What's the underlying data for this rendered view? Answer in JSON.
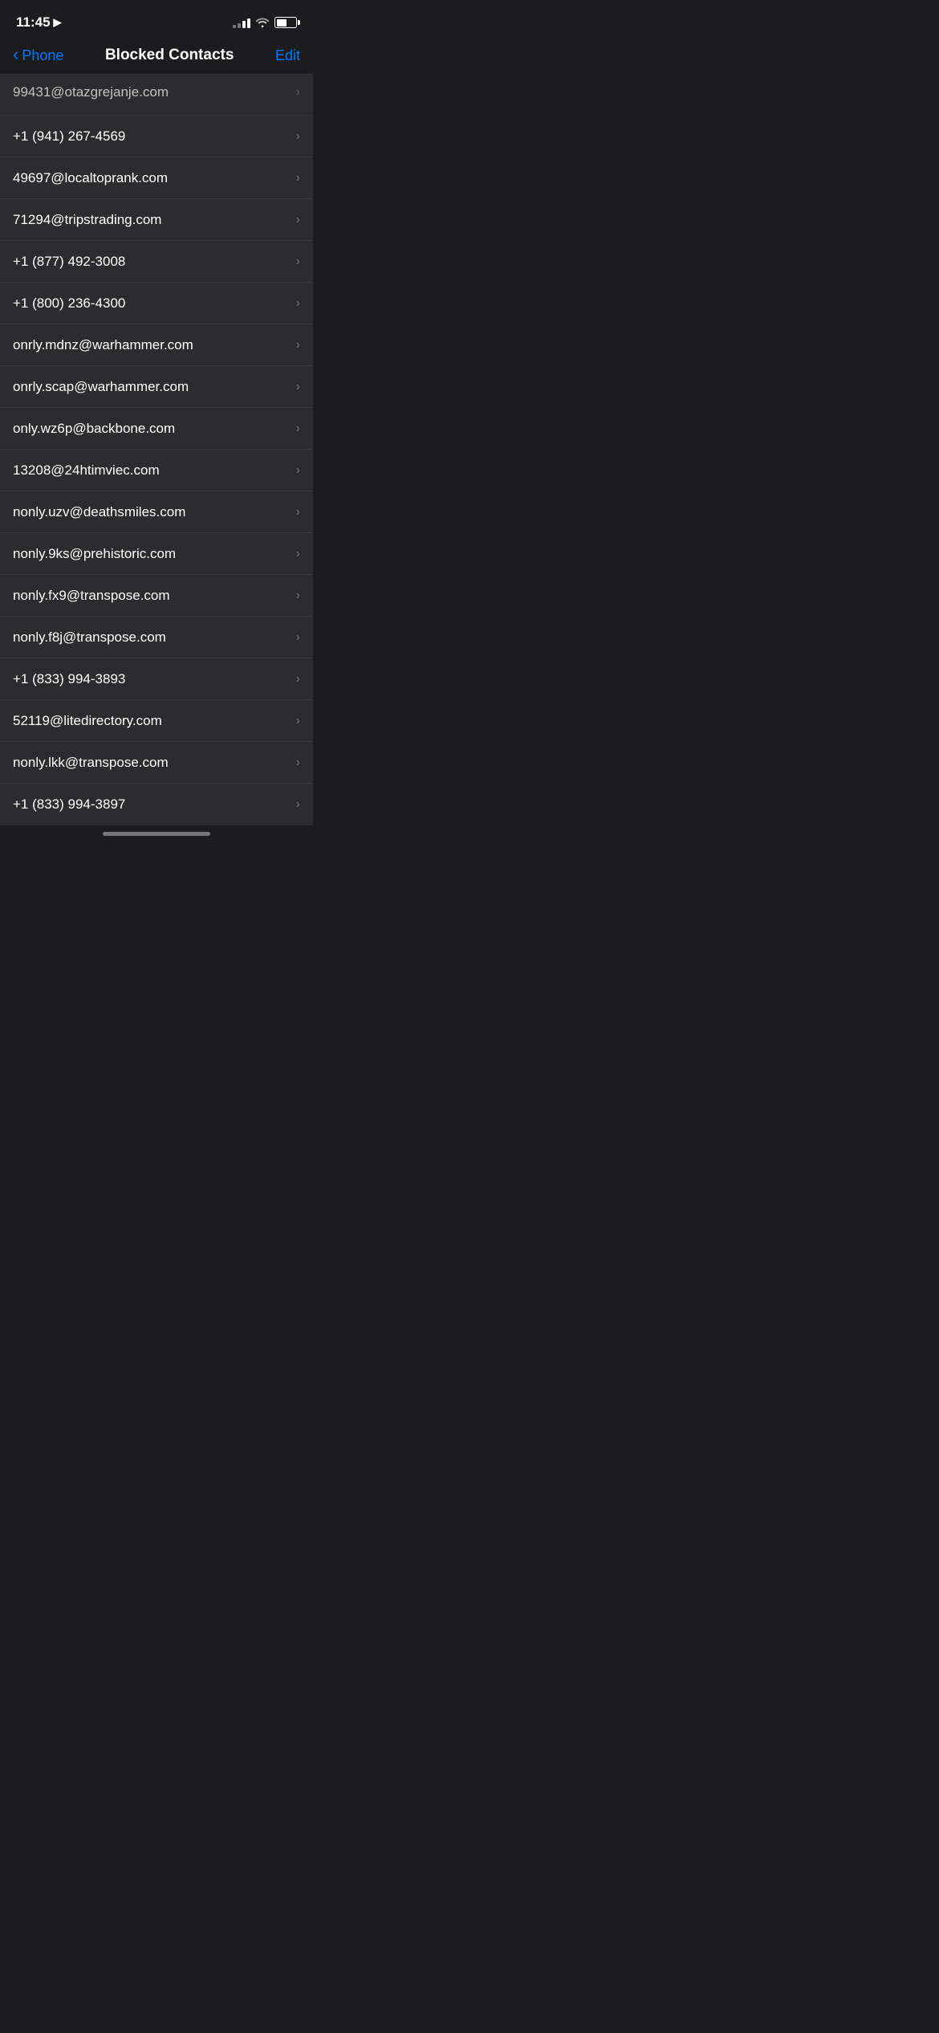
{
  "statusBar": {
    "time": "11:45",
    "locationIcon": "▶"
  },
  "navBar": {
    "backLabel": "Phone",
    "title": "Blocked Contacts",
    "editLabel": "Edit"
  },
  "contacts": [
    {
      "id": 1,
      "value": "99431@otazgrejanje.com",
      "partial": true
    },
    {
      "id": 2,
      "value": "+1 (941) 267-4569",
      "partial": false
    },
    {
      "id": 3,
      "value": "49697@localtoprank.com",
      "partial": false
    },
    {
      "id": 4,
      "value": "71294@tripstrading.com",
      "partial": false
    },
    {
      "id": 5,
      "value": "+1 (877) 492-3008",
      "partial": false
    },
    {
      "id": 6,
      "value": "+1 (800) 236-4300",
      "partial": false
    },
    {
      "id": 7,
      "value": "onrly.mdnz@warhammer.com",
      "partial": false
    },
    {
      "id": 8,
      "value": "onrly.scap@warhammer.com",
      "partial": false
    },
    {
      "id": 9,
      "value": "only.wz6p@backbone.com",
      "partial": false
    },
    {
      "id": 10,
      "value": "13208@24htimviec.com",
      "partial": false
    },
    {
      "id": 11,
      "value": "nonly.uzv@deathsmiles.com",
      "partial": false
    },
    {
      "id": 12,
      "value": "nonly.9ks@prehistoric.com",
      "partial": false
    },
    {
      "id": 13,
      "value": "nonly.fx9@transpose.com",
      "partial": false
    },
    {
      "id": 14,
      "value": "nonly.f8j@transpose.com",
      "partial": false
    },
    {
      "id": 15,
      "value": "+1 (833) 994-3893",
      "partial": false
    },
    {
      "id": 16,
      "value": "52119@litedirectory.com",
      "partial": false
    },
    {
      "id": 17,
      "value": "nonly.lkk@transpose.com",
      "partial": false
    },
    {
      "id": 18,
      "value": "+1 (833) 994-3897",
      "partial": false
    }
  ],
  "chevronSymbol": "›",
  "homeIndicator": true
}
